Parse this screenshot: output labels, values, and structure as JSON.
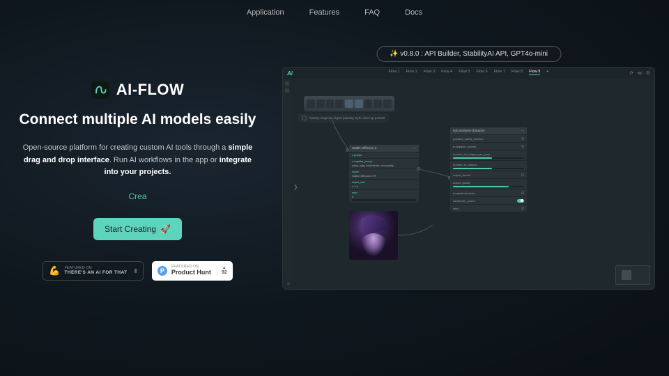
{
  "nav": {
    "application": "Application",
    "features": "Features",
    "faq": "FAQ",
    "docs": "Docs"
  },
  "brand": {
    "name": "AI-FLOW"
  },
  "headline": "Connect multiple AI models easily",
  "sub": {
    "p1": "Open-source platform for creating custom AI tools through a ",
    "b1": "simple drag and drop interface",
    "p2": ". Run AI workflows in the app or ",
    "b2": "integrate into your projects."
  },
  "typed": "Crea",
  "cta": "Start Creating",
  "badge1": {
    "top": "FEATURED ON",
    "bottom": "THERE'S AN AI FOR THAT"
  },
  "badge2": {
    "top": "FEATURED ON",
    "bottom": "Product Hunt",
    "votes": "92"
  },
  "pill": "✨ v0.8.0 : API Builder, StabilityAI API, GPT4o-mini",
  "tabs": [
    "Flow 1",
    "Flow 2",
    "Flow 3",
    "Flow 4",
    "Flow 5",
    "Flow 6",
    "Flow 7",
    "Flow 8",
    "Flow 9"
  ],
  "app_logo": "Ai",
  "prompt_text": "fantasy magician digital painting style close-up portrait",
  "sd": {
    "title": "Stable Diffusion 3",
    "rows": [
      {
        "lbl": "● prompt",
        "val": ""
      },
      {
        "lbl": "● negative_prompt",
        "val": "wavy, ugly, bad hands, low quality"
      },
      {
        "lbl": "model",
        "val": "Stable Diffusion 3 ▾"
      },
      {
        "lbl": "aspect_ratio",
        "val": "1:1 ▾"
      },
      {
        "lbl": "seed",
        "val": "0"
      }
    ]
  },
  "char": {
    "title": "hdconsistent-character",
    "rows": [
      "possible_safety_checker",
      "● negative_prompt",
      "number_of_images_per_pose",
      "number_of_outputs",
      "output_format",
      "output_quality",
      "● headshot photo",
      "randomize_poses",
      "seed"
    ]
  }
}
